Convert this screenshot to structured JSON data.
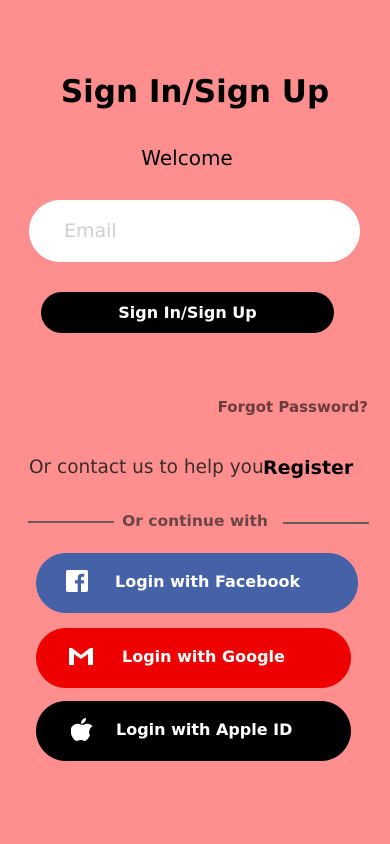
{
  "header": {
    "title": "Sign In/Sign Up",
    "subtitle": "Welcome"
  },
  "form": {
    "email_placeholder": "Email",
    "email_value": "",
    "submit_label": "Sign In/Sign Up",
    "forgot_label": "Forgot Password?"
  },
  "contact": {
    "text": "Or contact us to help you",
    "register_label": "Register"
  },
  "divider": {
    "text": "Or continue with"
  },
  "social": {
    "facebook_label": "Login with Facebook",
    "google_label": "Login with Google",
    "apple_label": "Login with Apple ID"
  },
  "colors": {
    "background": "#ff8f8f",
    "facebook": "#4562a8",
    "google": "#ef0000",
    "apple": "#000000"
  }
}
